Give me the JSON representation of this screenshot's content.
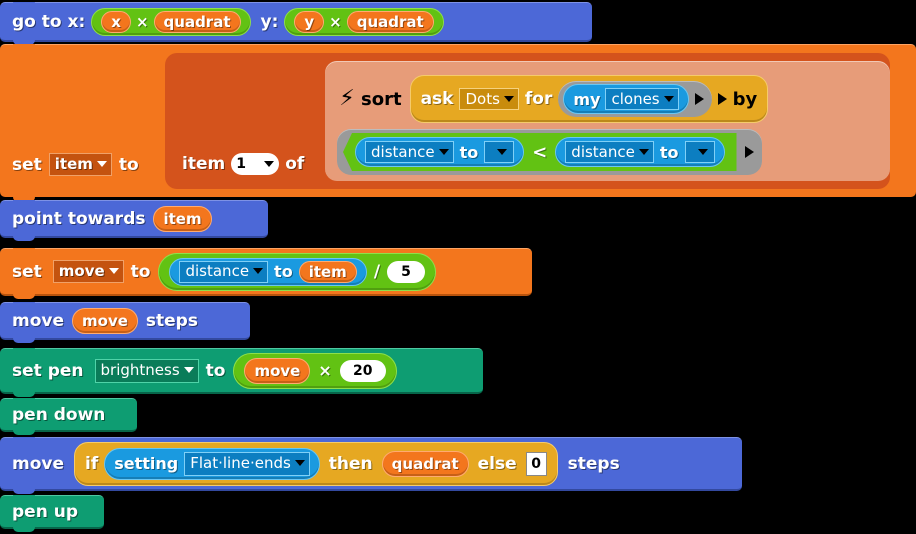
{
  "script": {
    "title": "Snap! block script",
    "blocks": [
      {
        "name": "go-to-xy",
        "label_go_to_x": "go to x:",
        "label_y": "y:",
        "x_operand_left": "x",
        "x_operand_op": "×",
        "x_operand_right": "quadrat",
        "y_operand_left": "y",
        "y_operand_op": "×",
        "y_operand_right": "quadrat"
      },
      {
        "name": "set-item-to-item-1-of-sort",
        "label_set": "set",
        "var_dropdown": "item",
        "label_to": "to",
        "label_item": "item",
        "index_value": "1",
        "label_of": "of",
        "sort_icon": "lightning-bolt-icon",
        "label_sort": "sort",
        "label_ask": "ask",
        "ask_target": "Dots",
        "label_for": "for",
        "attr_my": "my",
        "attr_dropdown": "clones",
        "label_by": "by",
        "cmp_left_name": "distance",
        "cmp_left_to": "to",
        "cmp_left_target": "",
        "cmp_operator": "<",
        "cmp_right_name": "distance",
        "cmp_right_to": "to",
        "cmp_right_target": ""
      },
      {
        "name": "point-towards",
        "label": "point towards",
        "target": "item"
      },
      {
        "name": "set-move-to",
        "label_set": "set",
        "var_dropdown": "move",
        "label_to": "to",
        "distance_name": "distance",
        "distance_to": "to",
        "distance_target": "item",
        "divide_op": "/",
        "divisor": "5"
      },
      {
        "name": "move-steps",
        "label_move": "move",
        "amount": "move",
        "label_steps": "steps"
      },
      {
        "name": "set-pen-brightness",
        "label_set_pen": "set pen",
        "attribute": "brightness",
        "label_to": "to",
        "factor": "move",
        "mul_op": "×",
        "multiplier": "20"
      },
      {
        "name": "pen-down",
        "label": "pen down"
      },
      {
        "name": "move-if-then-else-steps",
        "label_move": "move",
        "label_if": "if",
        "label_setting": "setting",
        "setting_value": "Flat·line·ends",
        "label_then": "then",
        "then_value": "quadrat",
        "label_else": "else",
        "else_value": "0",
        "label_steps": "steps"
      },
      {
        "name": "pen-up",
        "label": "pen up"
      }
    ]
  },
  "colors": {
    "motion": "#4C68D7",
    "variables": "#F3761D",
    "list": "#D4531C",
    "operators": "#62C213",
    "sensing": "#1A9AE0",
    "control": "#E6A822",
    "pen": "#0E9D72",
    "ring": "#9A9A9A",
    "sort_body": "#E79C79",
    "background": "#000000"
  }
}
